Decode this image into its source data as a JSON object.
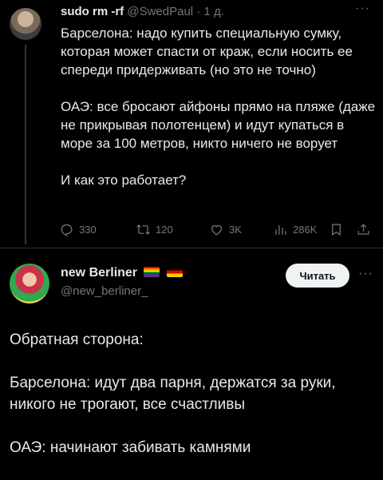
{
  "reply_tweet": {
    "author_name": "sudo rm -rf",
    "author_handle": "@SwedPaul",
    "separator": "·",
    "time": "1 д.",
    "more": "···",
    "paragraphs": [
      "Барселона: надо купить специальную сумку, которая может спасти от краж, если носить ее спереди придерживать (но это не точно)",
      "ОАЭ: все бросают айфоны прямо на пляже (даже не прикрывая полотенцем) и идут купаться в море за 100 метров, никто ничего не ворует",
      "И как это работает?"
    ],
    "stats": {
      "replies": "330",
      "retweets": "120",
      "likes": "3K",
      "views": "286K"
    },
    "icons": [
      "reply-icon",
      "retweet-icon",
      "like-icon",
      "views-icon",
      "bookmark-icon",
      "share-icon"
    ]
  },
  "main_tweet": {
    "author_name": "new Berliner",
    "flags": [
      "pride-flag",
      "germany-flag"
    ],
    "author_handle": "@new_berliner_",
    "follow_label": "Читать",
    "more": "···",
    "paragraphs": [
      "Обратная сторона:",
      "Барселона: идут два парня, держатся за руки, никого не трогают, все счастливы",
      "ОАЭ: начинают забивать камнями"
    ]
  },
  "colors": {
    "background": "#000000",
    "text": "#e7e9ea",
    "secondary": "#71767b",
    "button_bg": "#eff3f4"
  }
}
